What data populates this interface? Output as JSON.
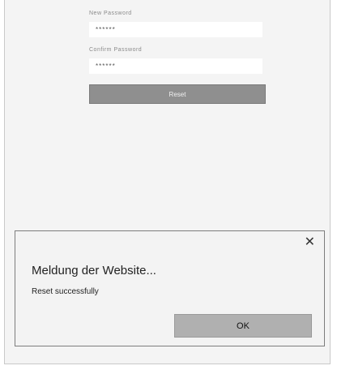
{
  "form": {
    "new_password_label": "New Password",
    "new_password_value": "******",
    "confirm_password_label": "Confirm Password",
    "confirm_password_value": "******",
    "reset_label": "Reset"
  },
  "dialog": {
    "close_glyph": "✕",
    "title": "Meldung der Website...",
    "message": "Reset successfully",
    "ok_label": "OK"
  },
  "icons": {
    "close": "close-icon"
  }
}
